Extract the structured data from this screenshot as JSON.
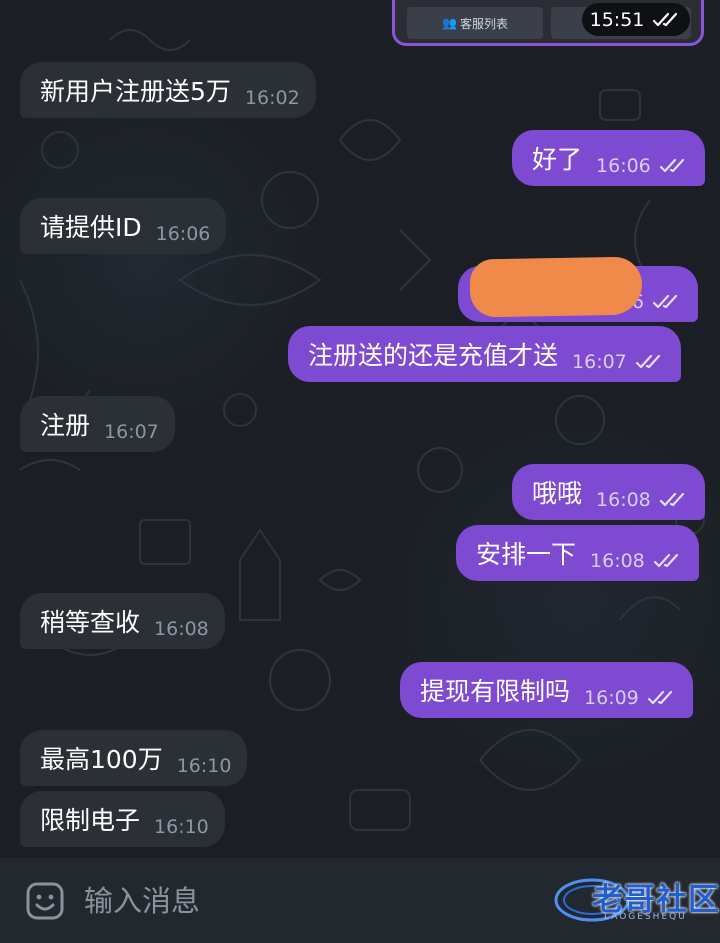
{
  "top_card": {
    "left_button": "客服列表",
    "right_button": "",
    "time": "15:51"
  },
  "messages": [
    {
      "text": "新用户注册送5万",
      "time": "16:02",
      "direction": "in"
    },
    {
      "text": "好了",
      "time": "16:06",
      "direction": "out",
      "read": true
    },
    {
      "text": "请提供ID",
      "time": "16:06",
      "direction": "in"
    },
    {
      "text": "",
      "time": "06",
      "direction": "out",
      "read": true,
      "redacted": true
    },
    {
      "text": "注册送的还是充值才送",
      "time": "16:07",
      "direction": "out",
      "read": true
    },
    {
      "text": "注册",
      "time": "16:07",
      "direction": "in"
    },
    {
      "text": "哦哦",
      "time": "16:08",
      "direction": "out",
      "read": true
    },
    {
      "text": "安排一下",
      "time": "16:08",
      "direction": "out",
      "read": true
    },
    {
      "text": "稍等查收",
      "time": "16:08",
      "direction": "in"
    },
    {
      "text": "提现有限制吗",
      "time": "16:09",
      "direction": "out",
      "read": true
    },
    {
      "text": "最高100万",
      "time": "16:10",
      "direction": "in"
    },
    {
      "text": "限制电子",
      "time": "16:10",
      "direction": "in"
    }
  ],
  "input": {
    "placeholder": "输入消息"
  },
  "watermark": {
    "text": "老哥社区",
    "subtext": "LAOGESHEQU"
  },
  "colors": {
    "background": "#1b1f25",
    "incoming_bubble": "#2b2f36",
    "outgoing_bubble": "#7e4ad1",
    "input_bar": "#23282f",
    "redaction": "#f08a4b"
  },
  "icons": {
    "read_receipt": "double-check-icon",
    "emoji": "sticker-smile-icon",
    "people": "people-icon"
  }
}
